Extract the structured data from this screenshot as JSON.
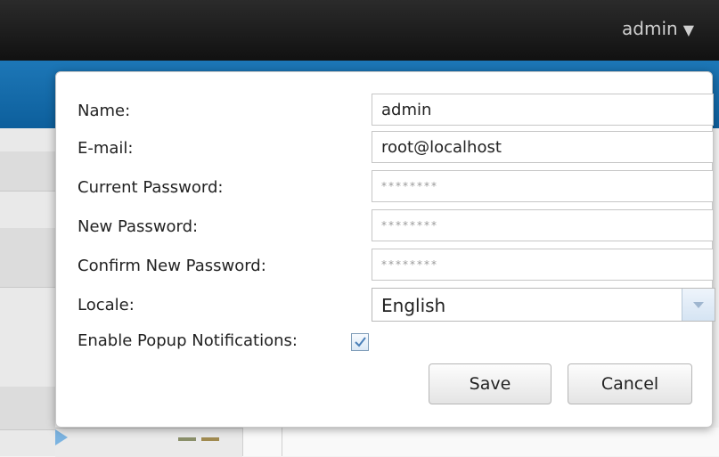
{
  "header": {
    "user_label": "admin",
    "user_caret": "▼"
  },
  "dialog": {
    "fields": {
      "name": {
        "label": "Name:",
        "value": "admin"
      },
      "email": {
        "label": "E-mail:",
        "value": "root@localhost"
      },
      "current_password": {
        "label": "Current Password:",
        "placeholder": "********"
      },
      "new_password": {
        "label": "New Password:",
        "placeholder": "********"
      },
      "confirm_password": {
        "label": "Confirm New Password:",
        "placeholder": "********"
      },
      "locale": {
        "label": "Locale:",
        "selected": "English"
      },
      "popup_notifications": {
        "label": "Enable Popup Notifications:",
        "checked": true
      }
    },
    "buttons": {
      "save": "Save",
      "cancel": "Cancel"
    }
  },
  "colors": {
    "topbar": "#1a1a1a",
    "accent_blue": "#1069ad",
    "checkbox_check": "#4a7fb8"
  }
}
